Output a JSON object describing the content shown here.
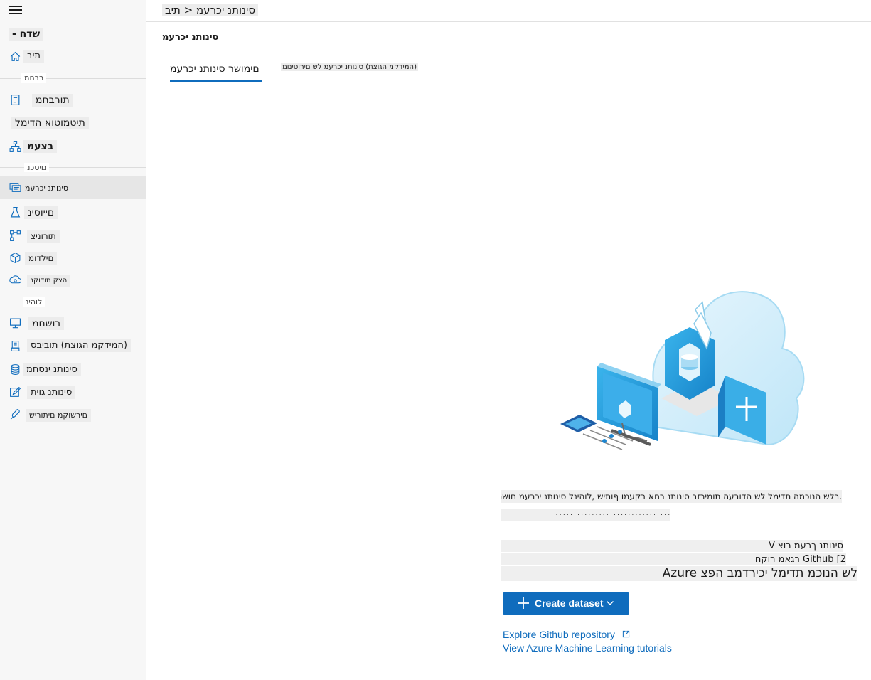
{
  "breadcrumb": "סינותנ יכרעמ < תיב",
  "page_title": "סינותנ יכרעמ",
  "sidebar": {
    "new_label": "שדח -",
    "home_label": "תיב",
    "section_author": "רבחמ",
    "section_assets": "םיסכנ",
    "section_manage": "לוהינ",
    "items": [
      {
        "label": "תורבחמ",
        "icon": "notebook-icon"
      },
      {
        "label": "תיטמוטוא הדימל",
        "icon": "automl-icon"
      },
      {
        "label": "בצעמ",
        "icon": "designer-icon"
      },
      {
        "label": "סינותנ יכרעמ",
        "icon": "datasets-icon"
      },
      {
        "label": "םייוסינ",
        "icon": "experiments-icon"
      },
      {
        "label": "תורוניצ",
        "icon": "pipelines-icon"
      },
      {
        "label": "םילדומ",
        "icon": "models-icon"
      },
      {
        "label": "הצק תודוקנ",
        "icon": "endpoints-icon"
      },
      {
        "label": "בושחמ",
        "icon": "compute-icon"
      },
      {
        "label": "(המידקמ הגוצת) תוביבס",
        "icon": "environments-icon"
      },
      {
        "label": "סינותנ ינסחמ",
        "icon": "datastores-icon"
      },
      {
        "label": "סינותנ גוית",
        "icon": "labeling-icon"
      },
      {
        "label": "םירשוקמ םיתוריש",
        "icon": "linked-services-icon"
      }
    ]
  },
  "tabs": [
    {
      "label": "םימושר סינותנ יכרעמ"
    },
    {
      "label": "(המידקמ הגוצת) סינותנ יכרעמ לש םירוטינומ"
    }
  ],
  "empty_state": {
    "description_line1": ".רלש הנוכמה תדימל לש הדובעה תומירזב סינותנ רחא בקעמו ףותיש ,לוהינל סינותנ יכרעמ םושר",
    "description_line2": ". . . . . . . . . . . . . . . . . . . . . . . . . . . . . . . .",
    "bullet1": "סינותנ ךרעמ רוצ V",
    "bullet2": "Github [2 רגאמ רוקח",
    "bullet3": "לש הנוכמ תדימל יכירדמב הפצ Azure",
    "create_button": "Create dataset",
    "link_github": "Explore Github repository",
    "link_tutorials": "View Azure Machine Learning tutorials"
  },
  "colors": {
    "accent": "#0f6cbd",
    "sidebar_bg": "#f7f7f7",
    "active_item_bg": "#e6e6e6"
  }
}
